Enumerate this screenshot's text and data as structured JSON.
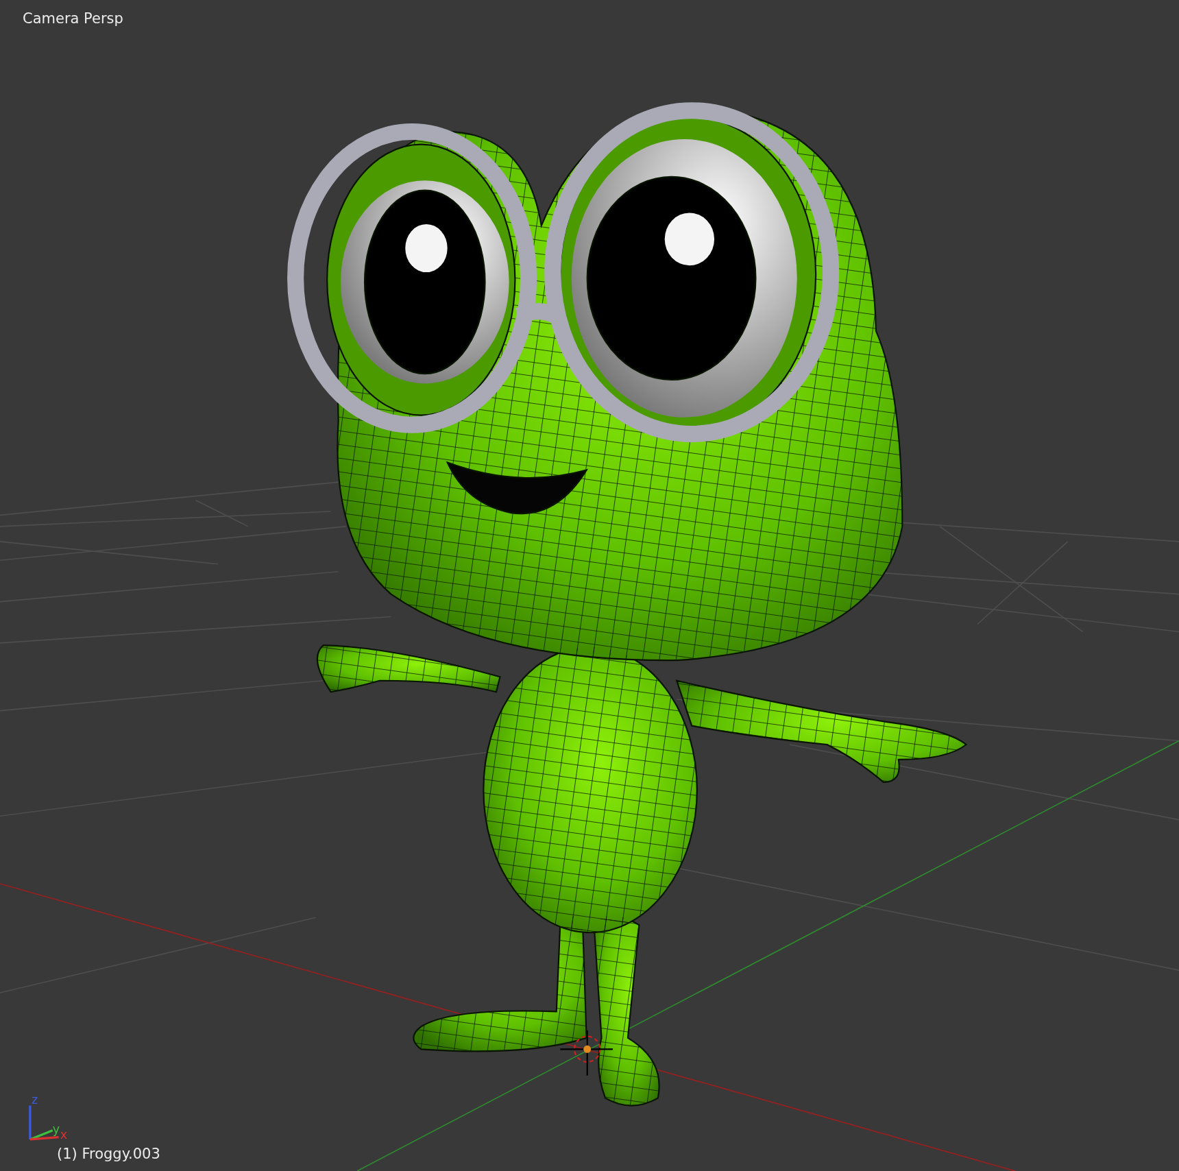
{
  "viewport": {
    "view_label": "Camera Persp",
    "object_label": "(1) Froggy.003",
    "axis_labels": [
      {
        "text": "z",
        "color": "#3b5bdb"
      },
      {
        "text": "y",
        "color": "#3fbf3f"
      },
      {
        "text": "x",
        "color": "#d93030"
      }
    ]
  }
}
